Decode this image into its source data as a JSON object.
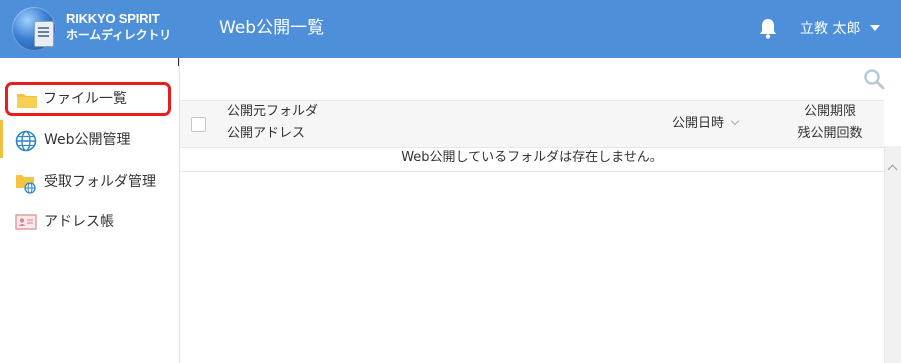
{
  "header": {
    "logo_line1": "RIKKYO SPIRIT",
    "logo_line2": "ホームディレクトリ",
    "page_title": "Web公開一覧",
    "user_name": "立教 太郎",
    "accent_color": "#4d90d9"
  },
  "sidebar": {
    "items": [
      {
        "label": "ファイル一覧",
        "icon": "folder-icon",
        "highlighted": true
      },
      {
        "label": "Web公開管理",
        "icon": "globe-icon"
      },
      {
        "label": "受取フォルダ管理",
        "icon": "shared-folder-icon"
      },
      {
        "label": "アドレス帳",
        "icon": "address-card-icon"
      }
    ],
    "highlight_color": "#e81d1d"
  },
  "table": {
    "col_folder_line1": "公開元フォルダ",
    "col_folder_line2": "公開アドレス",
    "col_date": "公開日時",
    "col_limit_line1": "公開期限",
    "col_limit_line2": "残公開回数",
    "empty_message": "Web公開しているフォルダは存在しません。"
  }
}
